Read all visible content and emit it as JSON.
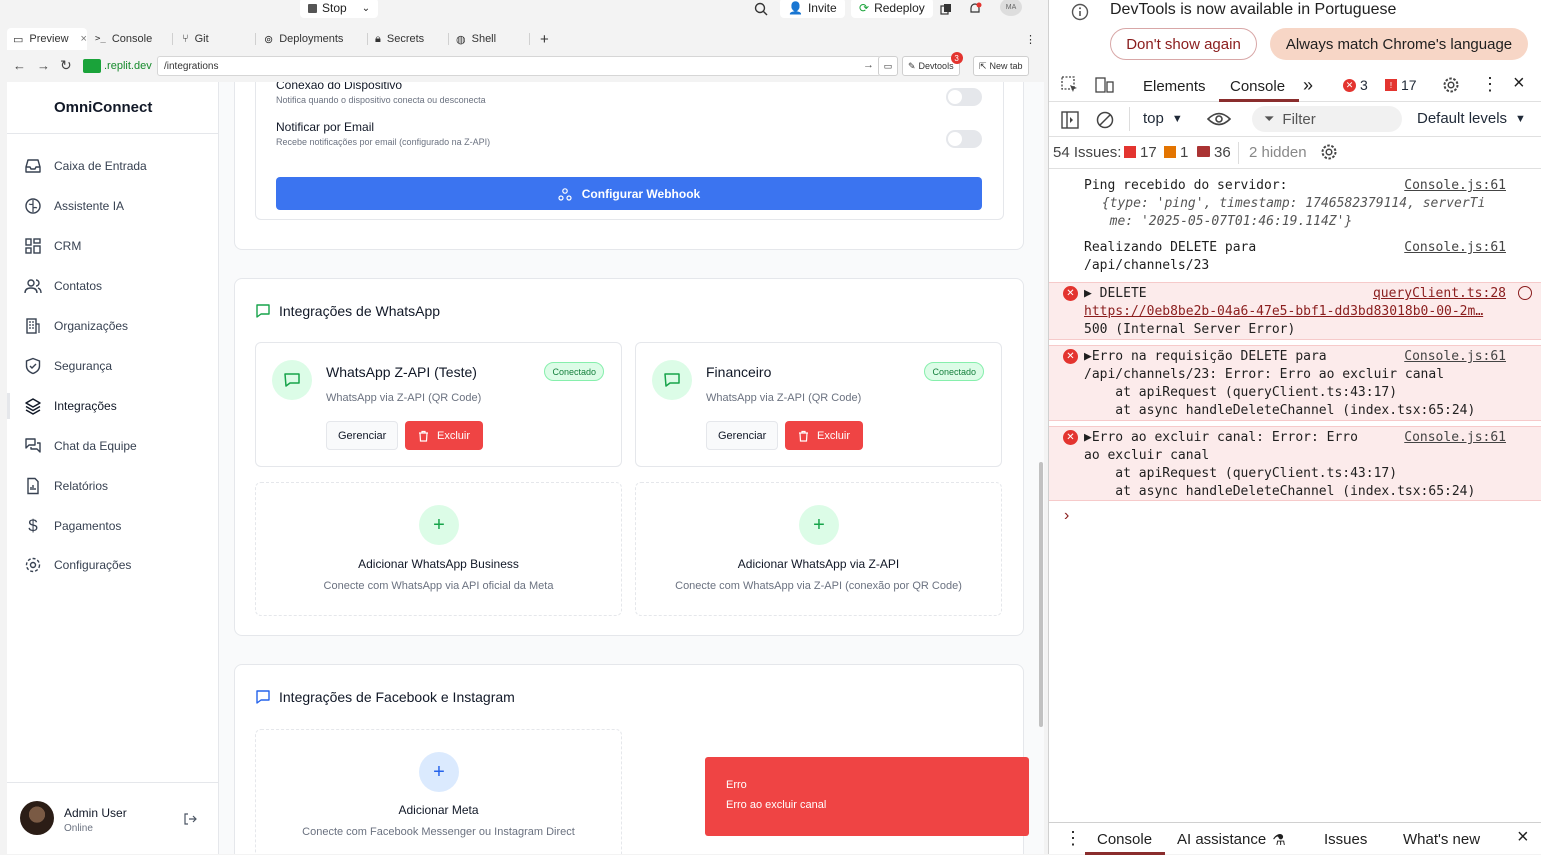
{
  "topbar": {
    "stop_label": "Stop",
    "invite_label": "Invite",
    "redeploy_label": "Redeploy",
    "avatar_initials": "MA"
  },
  "tabs": [
    {
      "label": "Preview",
      "icon": "monitor-icon"
    },
    {
      "label": "Console",
      "icon": "terminal-icon"
    },
    {
      "label": "Git",
      "icon": "git-icon"
    },
    {
      "label": "Deployments",
      "icon": "deploy-icon"
    },
    {
      "label": "Secrets",
      "icon": "lock-icon"
    },
    {
      "label": "Shell",
      "icon": "globe-icon"
    }
  ],
  "urlbar": {
    "domain": ".replit.dev",
    "path": "/integrations",
    "devtools_label": "Devtools",
    "devtools_badge": "3",
    "newtab_label": "New tab"
  },
  "sidebar": {
    "brand": "OmniConnect",
    "items": [
      {
        "label": "Caixa de Entrada",
        "icon": "inbox-icon"
      },
      {
        "label": "Assistente IA",
        "icon": "brain-icon"
      },
      {
        "label": "CRM",
        "icon": "grid-icon"
      },
      {
        "label": "Contatos",
        "icon": "users-icon"
      },
      {
        "label": "Organizações",
        "icon": "building-icon"
      },
      {
        "label": "Segurança",
        "icon": "shield-icon"
      },
      {
        "label": "Integrações",
        "icon": "layers-icon"
      },
      {
        "label": "Chat da Equipe",
        "icon": "chat-icon"
      },
      {
        "label": "Relatórios",
        "icon": "report-icon"
      },
      {
        "label": "Pagamentos",
        "icon": "dollar-icon"
      },
      {
        "label": "Configurações",
        "icon": "gear-icon"
      }
    ],
    "user": {
      "name": "Admin User",
      "status": "Online"
    }
  },
  "settings": {
    "device_title": "Conexão do Dispositivo",
    "device_desc": "Notifica quando o dispositivo conecta ou desconecta",
    "email_title": "Notificar por Email",
    "email_desc": "Recebe notificações por email (configurado na Z-API)",
    "webhook_button": "Configurar Webhook"
  },
  "whatsapp": {
    "section_title": "Integrações de WhatsApp",
    "channels": [
      {
        "title": "WhatsApp Z-API (Teste)",
        "sub": "WhatsApp via Z-API (QR Code)",
        "status": "Conectado",
        "manage": "Gerenciar",
        "delete": "Excluir"
      },
      {
        "title": "Financeiro",
        "sub": "WhatsApp via Z-API (QR Code)",
        "status": "Conectado",
        "manage": "Gerenciar",
        "delete": "Excluir"
      }
    ],
    "add_cards": [
      {
        "title": "Adicionar WhatsApp Business",
        "sub": "Conecte com WhatsApp via API oficial da Meta"
      },
      {
        "title": "Adicionar WhatsApp via Z-API",
        "sub": "Conecte com WhatsApp via Z-API (conexão por QR Code)"
      }
    ]
  },
  "facebook": {
    "section_title": "Integrações de Facebook e Instagram",
    "add_title": "Adicionar Meta",
    "add_sub": "Conecte com Facebook Messenger ou Instagram Direct"
  },
  "toast": {
    "title": "Erro",
    "message": "Erro ao excluir canal"
  },
  "devtools": {
    "info_message": "DevTools is now available in Portuguese",
    "dont_show": "Don't show again",
    "match_lang": "Always match Chrome's language",
    "tabs": [
      "Elements",
      "Console"
    ],
    "error_count": "3",
    "warn_count": "17",
    "context": "top",
    "filter_placeholder": "Filter",
    "levels": "Default levels",
    "issues_label": "54 Issues:",
    "issues_errors": "17",
    "issues_warn": "1",
    "issues_info": "36",
    "hidden": "2 hidden",
    "logs": [
      {
        "lines": [
          "Ping recebido do servidor:",
          " {type: 'ping', timestamp: 1746582379114, serverTi",
          "  me: '2025-05-07T01:46:19.114Z'}"
        ],
        "src": "Console.js:61",
        "level": "info"
      },
      {
        "lines": [
          "Realizando DELETE para",
          "/api/channels/23"
        ],
        "src": "Console.js:61",
        "level": "info"
      },
      {
        "lines": [
          "▶ DELETE",
          "https://0eb8be2b-04a6-47e5-bbf1-dd3bd83018b0-00-2m…",
          "500 (Internal Server Error)"
        ],
        "src": "queryClient.ts:28",
        "level": "error"
      },
      {
        "lines": [
          "▶Erro na requisição DELETE para",
          "/api/channels/23: Error: Erro ao excluir canal",
          "    at apiRequest (queryClient.ts:43:17)",
          "    at async handleDeleteChannel (index.tsx:65:24)"
        ],
        "src": "Console.js:61",
        "level": "error"
      },
      {
        "lines": [
          "▶Erro ao excluir canal: Error: Erro",
          "ao excluir canal",
          "    at apiRequest (queryClient.ts:43:17)",
          "    at async handleDeleteChannel (index.tsx:65:24)"
        ],
        "src": "Console.js:61",
        "level": "error"
      }
    ],
    "bottom_tabs": [
      "Console",
      "AI assistance",
      "Issues",
      "What's new"
    ]
  }
}
